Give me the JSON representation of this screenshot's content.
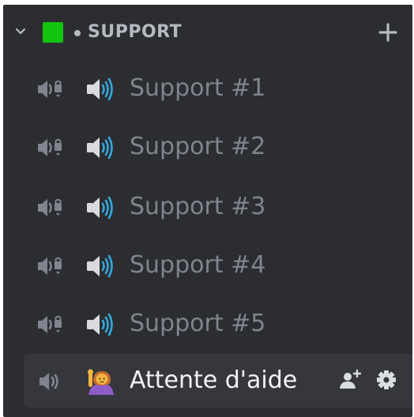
{
  "category": {
    "title": "SUPPORT",
    "square_color": "#11c40f",
    "collapse_icon": "chevron-down-icon",
    "add_icon": "plus-icon"
  },
  "channels": [
    {
      "label": "Support #1",
      "lock_icon": "locked-voice-icon",
      "emoji": "speaker-high-volume-emoji"
    },
    {
      "label": "Support #2",
      "lock_icon": "locked-voice-icon",
      "emoji": "speaker-high-volume-emoji"
    },
    {
      "label": "Support #3",
      "lock_icon": "locked-voice-icon",
      "emoji": "speaker-high-volume-emoji"
    },
    {
      "label": "Support #4",
      "lock_icon": "locked-voice-icon",
      "emoji": "speaker-high-volume-emoji"
    },
    {
      "label": "Support #5",
      "lock_icon": "locked-voice-icon",
      "emoji": "speaker-high-volume-emoji"
    }
  ],
  "waiting_channel": {
    "label": "Attente d'aide",
    "voice_icon": "speaker-icon",
    "emoji": "person-raising-hand-emoji",
    "actions": [
      "invite-icon",
      "gear-icon"
    ]
  },
  "colors": {
    "background": "#2b2d31",
    "active_row": "#35373c",
    "muted_text": "#80848e",
    "active_text": "#f2f3f5",
    "speaker_blue": "#35a8dc"
  }
}
